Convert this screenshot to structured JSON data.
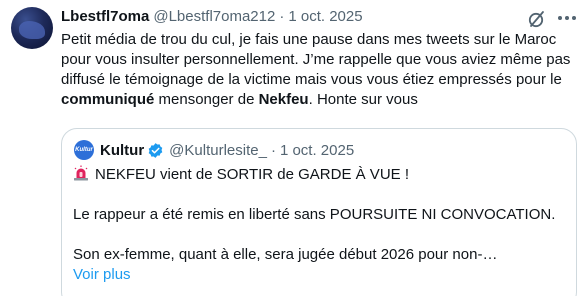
{
  "tweet": {
    "author_name": "Lbestfl7oma",
    "author_handle": "@Lbestfl7oma212",
    "separator": "·",
    "date": "1 oct. 2025",
    "text_part1": "Petit média de trou du cul, je fais une pause dans mes tweets sur le Maroc pour vous insulter personnellement. J’me rappelle que vous aviez même pas diffusé le témoignage de la victime mais vous vous étiez empressés pour le ",
    "text_bold1": "communiqué",
    "text_part2": " mensonger de ",
    "text_bold2": "Nekfeu",
    "text_part3": ". Honte sur vous"
  },
  "quote": {
    "avatar_text": "Kultur",
    "author_name": "Kultur",
    "author_handle": "@Kulturlesite_",
    "separator": "·",
    "date": "1 oct. 2025",
    "line1": "NEKFEU vient de SORTIR de GARDE À VUE !",
    "line2": "Le rappeur a été remis en liberté sans POURSUITE NI CONVOCATION.",
    "line3": "Son ex-femme, quant à elle, sera jugée début 2026 pour non-…",
    "show_more": "Voir plus"
  },
  "icons": {
    "grok": "grok-icon",
    "more": "more-icon",
    "verified": "verified-icon",
    "siren": "siren-icon"
  },
  "colors": {
    "text": "#0f1419",
    "secondary": "#536471",
    "link": "#1d9bf0",
    "border": "#cfd9de"
  }
}
